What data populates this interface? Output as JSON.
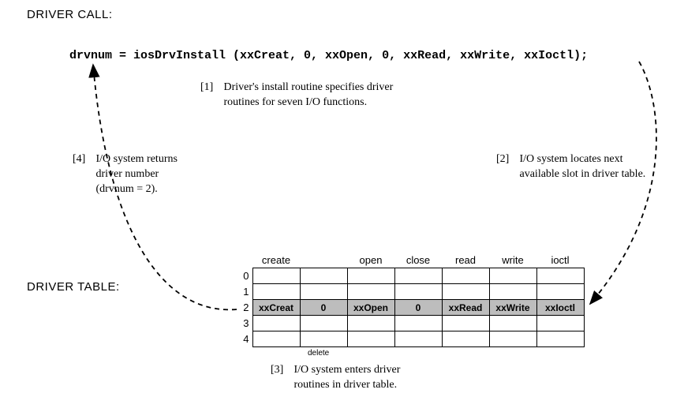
{
  "headings": {
    "driver_call": "DRIVER CALL:",
    "driver_table": "DRIVER TABLE:"
  },
  "code_line": "drvnum = iosDrvInstall (xxCreat, 0, xxOpen, 0, xxRead, xxWrite, xxIoctl);",
  "steps": {
    "s1": {
      "num": "[1]",
      "text": "Driver's install routine specifies driver\nroutines for seven I/O functions."
    },
    "s2": {
      "num": "[2]",
      "text": "I/O system locates next\navailable slot in driver table."
    },
    "s3": {
      "num": "[3]",
      "text": "I/O system enters driver\nroutines in driver table."
    },
    "s4": {
      "num": "[4]",
      "text": "I/O system returns\ndriver number\n(drvnum = 2)."
    }
  },
  "table": {
    "columns": [
      "create",
      "",
      "open",
      "close",
      "read",
      "write",
      "ioctl"
    ],
    "row_indices": [
      "0",
      "1",
      "2",
      "3",
      "4"
    ],
    "filled_row_index": 2,
    "filled_row": [
      "xxCreat",
      "0",
      "xxOpen",
      "0",
      "xxRead",
      "xxWrite",
      "xxIoctl"
    ],
    "delete_label": "delete"
  }
}
